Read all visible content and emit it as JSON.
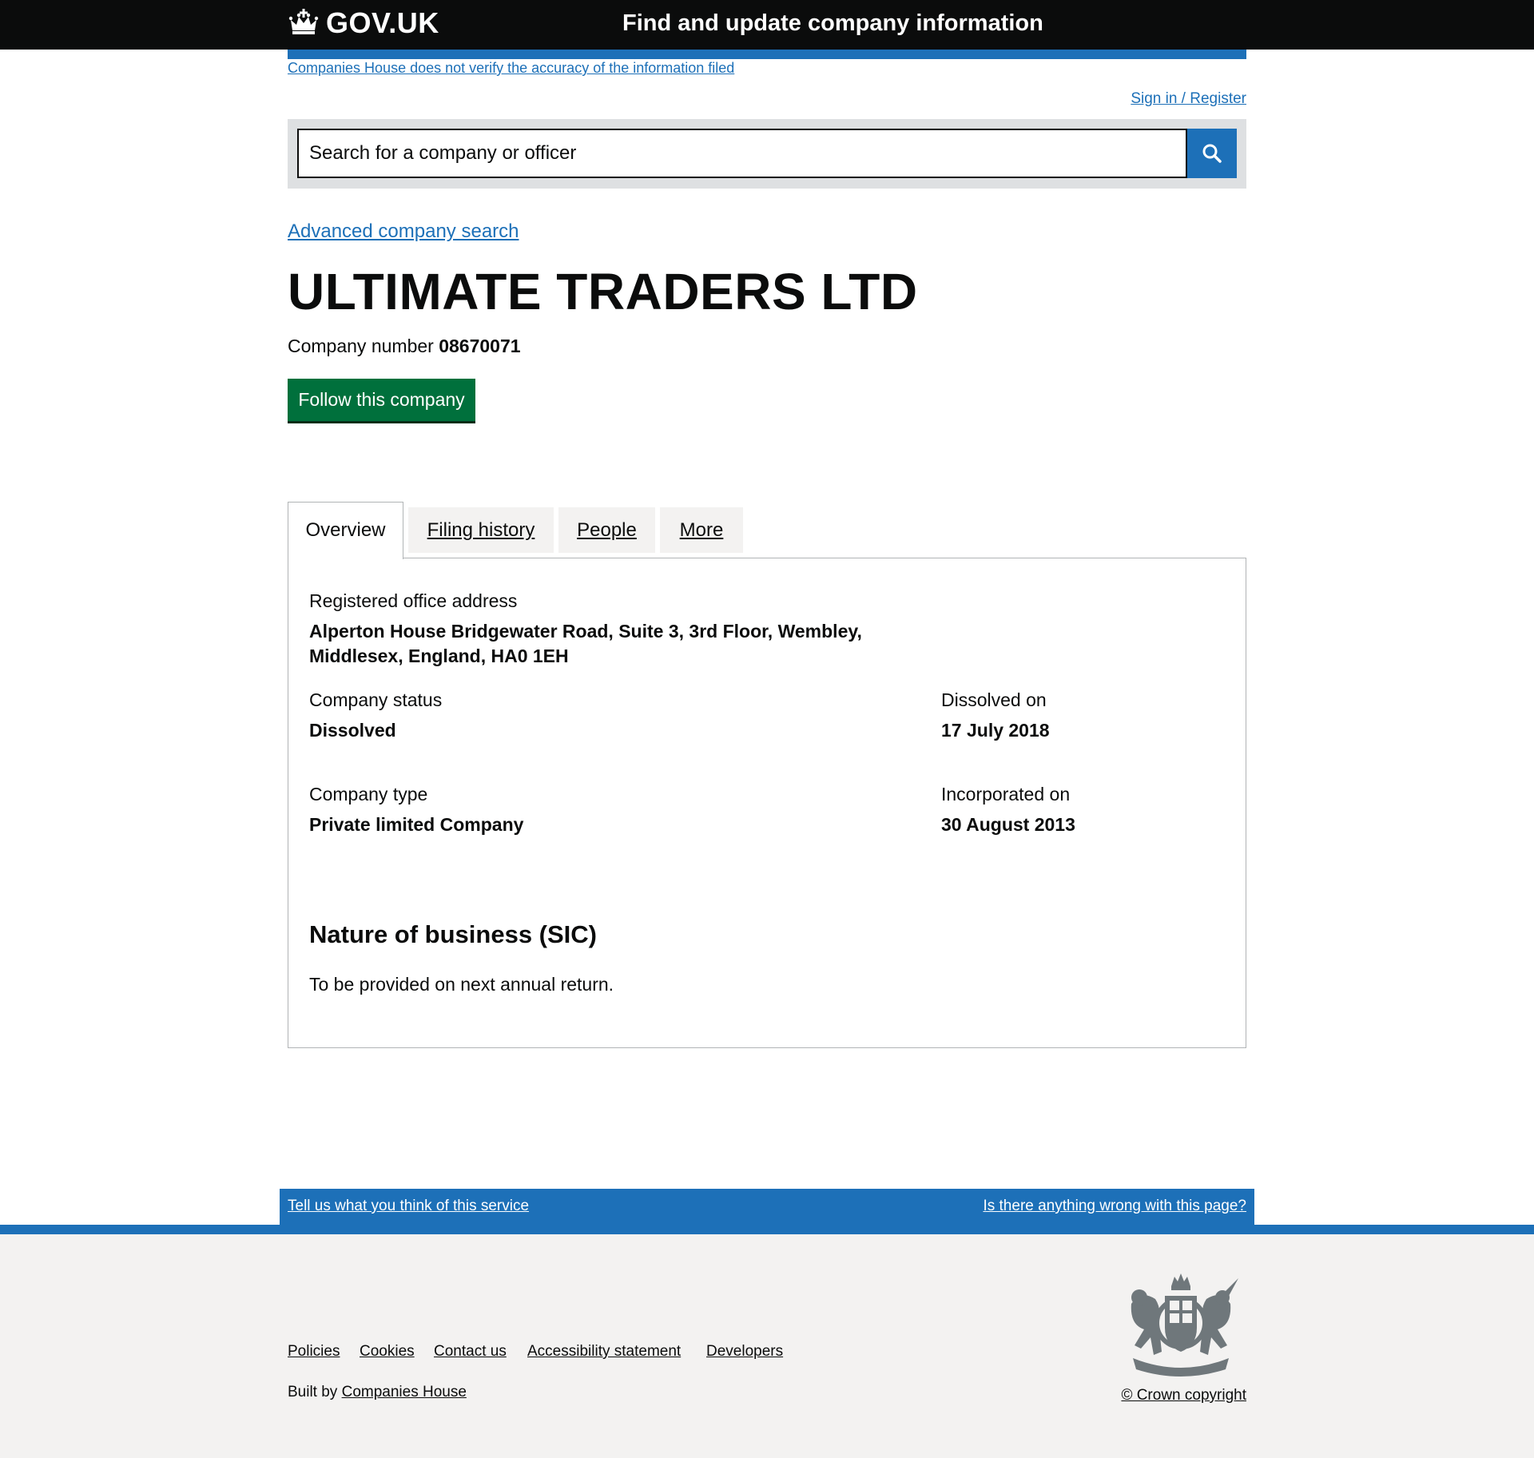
{
  "header": {
    "logo_text": "GOV.UK",
    "service_name": "Find and update company information"
  },
  "notice": "Companies House does not verify the accuracy of the information filed",
  "signin": "Sign in / Register",
  "search": {
    "placeholder": "Search for a company or officer"
  },
  "advanced_search": "Advanced company search",
  "company": {
    "name": "ULTIMATE TRADERS LTD",
    "number_label": "Company number",
    "number": "08670071",
    "follow_label": "Follow this company"
  },
  "tabs": [
    {
      "label": "Overview",
      "active": true
    },
    {
      "label": "Filing history",
      "active": false
    },
    {
      "label": "People",
      "active": false
    },
    {
      "label": "More",
      "active": false
    }
  ],
  "overview": {
    "address_label": "Registered office address",
    "address_line1": "Alperton House Bridgewater Road, Suite 3, 3rd Floor, Wembley,",
    "address_line2": "Middlesex, England, HA0 1EH",
    "status_label": "Company status",
    "status": "Dissolved",
    "dissolved_label": "Dissolved on",
    "dissolved": "17 July 2018",
    "type_label": "Company type",
    "type": "Private limited Company",
    "incorporated_label": "Incorporated on",
    "incorporated": "30 August 2013",
    "sic_heading": "Nature of business (SIC)",
    "sic_text": "To be provided on next annual return."
  },
  "feedback": {
    "left": "Tell us what you think of this service",
    "right": "Is there anything wrong with this page?"
  },
  "footer": {
    "links": [
      "Policies",
      "Cookies",
      "Contact us",
      "Accessibility statement",
      "Developers"
    ],
    "built_by_prefix": "Built by",
    "built_by_link": "Companies House",
    "copyright": "© Crown copyright"
  },
  "colors": {
    "header_bg": "#0b0c0c",
    "link_blue": "#1d70b8",
    "button_green": "#00703c",
    "footer_bg": "#f3f2f1"
  },
  "icons": [
    "crown-icon",
    "search-icon",
    "royal-crest-icon"
  ]
}
